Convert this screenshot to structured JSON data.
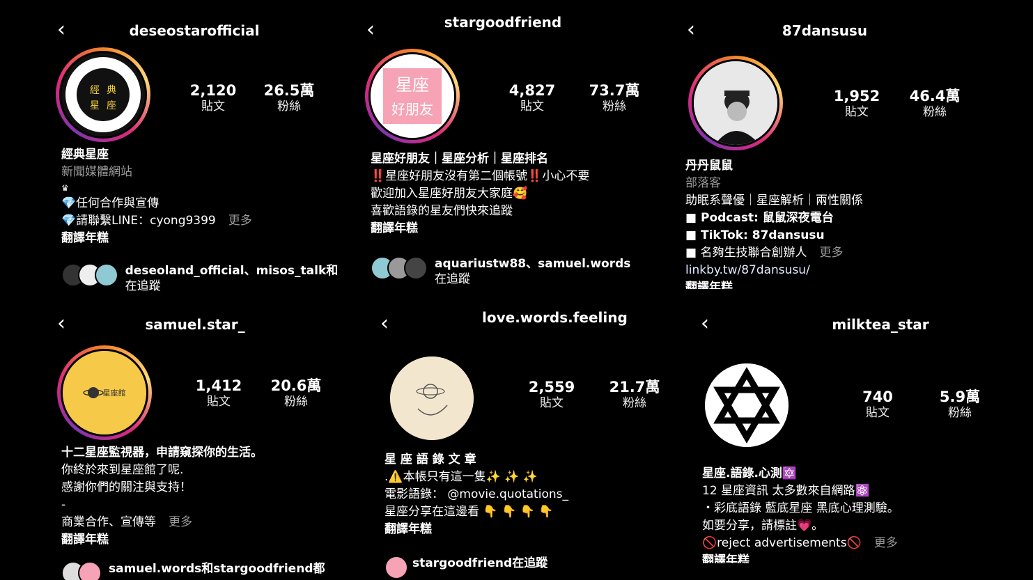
{
  "profiles": [
    {
      "username": "deseostarofficial",
      "posts": "2,120",
      "posts_label": "貼文",
      "followers": "26.5萬",
      "followers_label": "粉絲",
      "name": "經典星座",
      "category": "新聞媒體網站",
      "bio": [
        "♛",
        "💎任何合作與宣傳",
        "💎請聯繫LINE：cyong9399"
      ],
      "more": "更多",
      "translate": "翻譯年糕",
      "followed_by": "deseoland_official、misos_talk和",
      "followed_by_suffix": "在追蹤"
    },
    {
      "username": "stargoodfriend",
      "posts": "4,827",
      "posts_label": "貼文",
      "followers": "73.7萬",
      "followers_label": "粉絲",
      "name": "星座好朋友｜星座分析｜星座排名",
      "bio": [
        "‼️星座好朋友沒有第二個帳號‼️小心不要",
        "歡迎加入星座好朋友大家庭🥰",
        "喜歡語錄的星友們快來追蹤"
      ],
      "translate": "翻譯年糕",
      "followed_by": "aquariustw88、samuel.words",
      "followed_by_suffix": "在追蹤"
    },
    {
      "username": "87dansusu",
      "posts": "1,952",
      "posts_label": "貼文",
      "followers": "46.4萬",
      "followers_label": "粉絲",
      "name": "丹丹鼠鼠",
      "category": "部落客",
      "bio": [
        "助眠系聲優｜星座解析｜兩性關係",
        "■ Podcast: 鼠鼠深夜電台",
        "■ TikTok: 87dansusu",
        "■ 名夠生技聯合創辦人"
      ],
      "more": "更多",
      "link": "linkby.tw/87dansusu/",
      "translate": "翻譯年糕"
    },
    {
      "username": "samuel.star_",
      "posts": "1,412",
      "posts_label": "貼文",
      "followers": "20.6萬",
      "followers_label": "粉絲",
      "name": "十二星座監視器，申請窺探你的生活。",
      "bio": [
        "你終於來到星座館了呢.",
        "感謝你們的關注與支持！",
        "-",
        "商業合作、宣傳等"
      ],
      "more": "更多",
      "translate": "翻譯年糕",
      "followed_by": "samuel.words和stargoodfriend都",
      "followed_by_suffix": ""
    },
    {
      "username": "love.words.feeling",
      "posts": "2,559",
      "posts_label": "貼文",
      "followers": "21.7萬",
      "followers_label": "粉絲",
      "name": "星 座 語 錄 文 章",
      "bio": [
        ".⚠️本帳只有這一隻✨ ✨ ✨",
        "電影語錄： @movie.quotations_",
        "星座分享在這邊看 👇 👇 👇 👇"
      ],
      "translate": "翻譯年糕",
      "followed_by": "stargoodfriend在追蹤",
      "followed_by_suffix": ""
    },
    {
      "username": "milktea_star",
      "posts": "740",
      "posts_label": "貼文",
      "followers": "5.9萬",
      "followers_label": "粉絲",
      "name": "星座.語錄.心測🔯",
      "bio": [
        "12 星座資訊 太多數來自網路⚛️",
        "・彩底語錄 藍底星座 黑底心理測驗。",
        "如要分享，請標註💗。",
        "🚫reject advertisements🚫"
      ],
      "more": "更多",
      "translate": "翻譯年糕"
    }
  ],
  "back_icon": "chevron-left-icon",
  "colors": {
    "background": "#000000",
    "story_ring": "#dd2a7b",
    "avatar_yellow": "#f7c948",
    "avatar_pink": "#f5a3b5"
  }
}
